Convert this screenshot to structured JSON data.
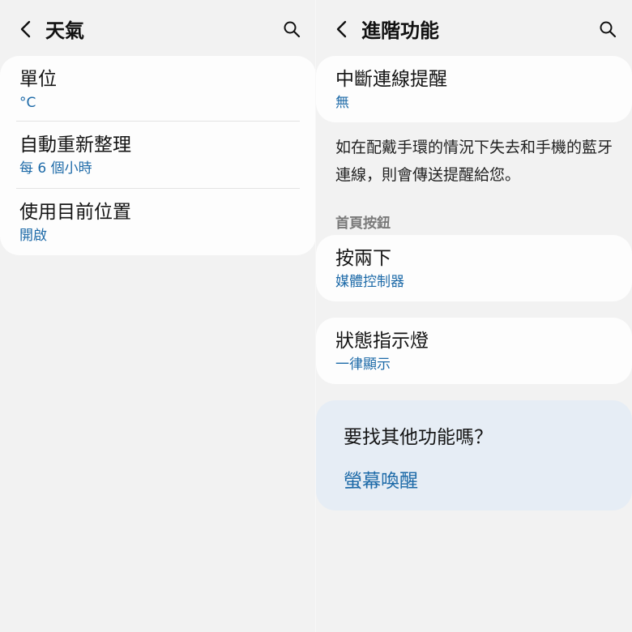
{
  "left": {
    "title": "天氣",
    "items": [
      {
        "label": "單位",
        "value": "°C"
      },
      {
        "label": "自動重新整理",
        "value": "每 6 個小時"
      },
      {
        "label": "使用目前位置",
        "value": "開啟"
      }
    ]
  },
  "right": {
    "title": "進階功能",
    "disconnect": {
      "label": "中斷連線提醒",
      "value": "無"
    },
    "description": "如在配戴手環的情況下失去和手機的藍牙連線，則會傳送提醒給您。",
    "section_header": "首頁按鈕",
    "double_press": {
      "label": "按兩下",
      "value": "媒體控制器"
    },
    "status_light": {
      "label": "狀態指示燈",
      "value": "一律顯示"
    },
    "suggest": {
      "title": "要找其他功能嗎？",
      "link": "螢幕喚醒"
    }
  },
  "colors": {
    "accent": "#1d6aa8",
    "background": "#f2f2f2",
    "card": "#fdfdfd",
    "suggest_bg": "#e6edf5"
  }
}
